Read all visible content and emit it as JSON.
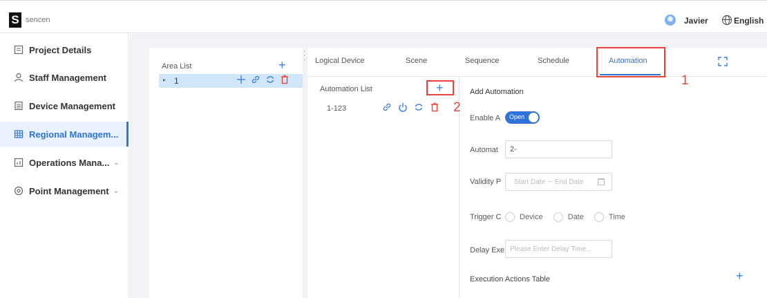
{
  "header": {
    "logo_letter": "S",
    "logo_text": "sencen",
    "user_name": "Javier",
    "language": "English"
  },
  "sidebar": {
    "items": [
      {
        "label": "Project Details",
        "icon": "document-icon"
      },
      {
        "label": "Staff Management",
        "icon": "person-icon"
      },
      {
        "label": "Device Management",
        "icon": "list-icon"
      },
      {
        "label": "Regional Managem...",
        "icon": "grid-icon",
        "active": true
      },
      {
        "label": "Operations Mana...",
        "icon": "chart-icon",
        "chevron": "⌄"
      },
      {
        "label": "Point Management",
        "icon": "location-icon",
        "chevron": "⌄"
      }
    ]
  },
  "area_list": {
    "title": "Area List",
    "add_symbol": "+",
    "tree": [
      {
        "label": "1",
        "caret": "▸"
      }
    ]
  },
  "tabs": {
    "items": [
      "Logical Device",
      "Scene",
      "Sequence",
      "Schedule",
      "Automation"
    ],
    "active": "Automation"
  },
  "annotations": {
    "one": "1",
    "two": "2"
  },
  "automation_list": {
    "title": "Automation List",
    "add_symbol": "+",
    "rows": [
      {
        "label": "1-123"
      }
    ]
  },
  "form": {
    "title": "Add Automation",
    "enable_label": "Enable A",
    "toggle_text": "Open",
    "name_label": "Automat",
    "name_value": "2-",
    "validity_label": "Validity P",
    "start_placeholder": "Start Date",
    "range_separator": "~",
    "end_placeholder": "End Date",
    "trigger_label": "Trigger C",
    "trigger_options": [
      "Device",
      "Date",
      "Time"
    ],
    "delay_label": "Delay Exe",
    "delay_placeholder": "Please Enter Delay Time...",
    "exec_title": "Execution Actions Table",
    "exec_add": "+"
  },
  "colors": {
    "accent": "#2f72d8",
    "danger": "#e8443a",
    "highlight_row": "#cfe6fb"
  }
}
